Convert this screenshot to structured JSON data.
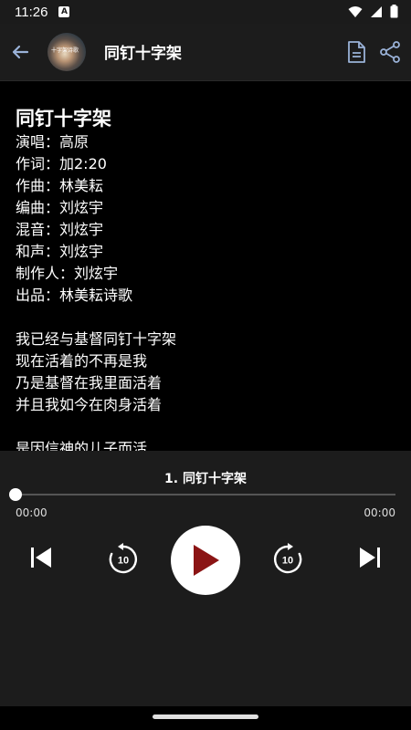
{
  "status": {
    "time": "11:26",
    "notification": "A"
  },
  "appbar": {
    "title": "同钉十字架",
    "cover_text": "十字架诗歌"
  },
  "lyrics": {
    "title": "同钉十字架",
    "credits": [
      "演唱：高原",
      "作词：加2:20",
      "作曲：林美耘",
      "编曲：刘炫宇",
      "混音：刘炫宇",
      "和声：刘炫宇",
      "制作人：刘炫宇",
      "出品：林美耘诗歌"
    ],
    "verse1": [
      "我已经与基督同钉十字架",
      "现在活着的不再是我",
      "乃是基督在我里面活着",
      "并且我如今在肉身活着"
    ],
    "verse2": [
      "是因信神的儿子而活"
    ]
  },
  "player": {
    "track_title": "1. 同钉十字架",
    "elapsed": "00:00",
    "total": "00:00",
    "progress_fraction": 0,
    "rewind_seconds": "10",
    "forward_seconds": "10"
  },
  "colors": {
    "play_icon": "#8b1414",
    "background": "#000000",
    "panel": "#1c1c1c"
  },
  "icons": [
    "back-arrow-icon",
    "lyrics-document-icon",
    "share-icon",
    "skip-previous-icon",
    "rewind-10-icon",
    "play-icon",
    "forward-10-icon",
    "skip-next-icon"
  ]
}
